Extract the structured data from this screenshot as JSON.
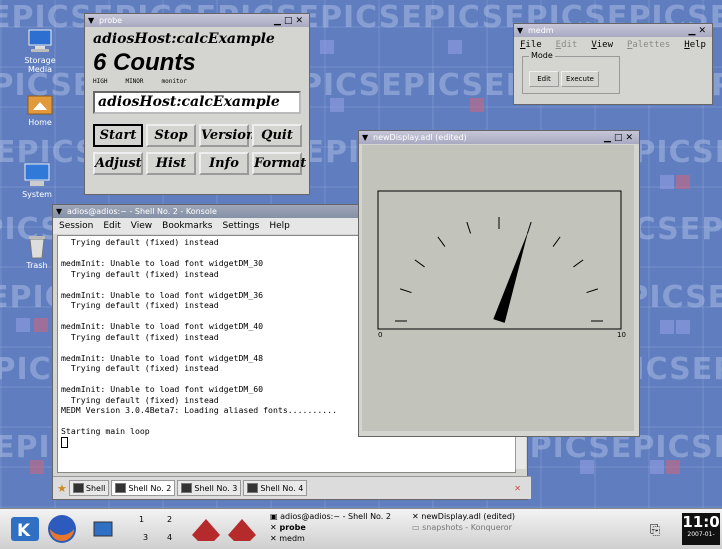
{
  "wallpaper": {
    "text": "EPICS"
  },
  "desktop_icons": [
    {
      "label": "Storage Media"
    },
    {
      "label": "Home"
    },
    {
      "label": "System"
    },
    {
      "label": "Trash"
    }
  ],
  "probe": {
    "title": "probe",
    "pv_name": "adiosHost:calcExample",
    "value": "6 Counts",
    "limit_labels": [
      "HIGH",
      "MINOR",
      "monitor"
    ],
    "entry_value": "adiosHost:calcExample",
    "buttons": [
      "Start",
      "Stop",
      "Version",
      "Quit",
      "Adjust",
      "Hist",
      "Info",
      "Format"
    ]
  },
  "medm": {
    "title": "medm",
    "menu": [
      "File",
      "Edit",
      "View",
      "Palettes",
      "Help"
    ],
    "mode_label": "Mode",
    "mode_buttons": [
      "Edit",
      "Execute"
    ]
  },
  "newdisplay": {
    "title": "newDisplay.adl (edited)",
    "meter": {
      "min_label": "0",
      "max_label": "10",
      "min": 0,
      "max": 10,
      "value": 6
    }
  },
  "konsole": {
    "title": "adios@adios:~ - Shell No. 2 - Konsole",
    "menu": [
      "Session",
      "Edit",
      "View",
      "Bookmarks",
      "Settings",
      "Help"
    ],
    "lines": [
      "  Trying default (fixed) instead",
      "",
      "medmInit: Unable to load font widgetDM_30",
      "  Trying default (fixed) instead",
      "",
      "medmInit: Unable to load font widgetDM_36",
      "  Trying default (fixed) instead",
      "",
      "medmInit: Unable to load font widgetDM_40",
      "  Trying default (fixed) instead",
      "",
      "medmInit: Unable to load font widgetDM_48",
      "  Trying default (fixed) instead",
      "",
      "medmInit: Unable to load font widgetDM_60",
      "  Trying default (fixed) instead",
      "MEDM Version 3.0.4Beta7: Loading aliased fonts..........",
      "",
      "Starting main loop",
      ""
    ],
    "tabs": [
      "Shell",
      "Shell No. 2",
      "Shell No. 3",
      "Shell No. 4"
    ]
  },
  "taskbar": {
    "desktops": [
      "1",
      "2",
      "3",
      "4"
    ],
    "tasks": [
      {
        "label": "adios@adios:~ - Shell No. 2"
      },
      {
        "label": "probe"
      },
      {
        "label": "medm"
      },
      {
        "label": "newDisplay.adl (edited)"
      },
      {
        "label": "snapshots - Konqueror"
      }
    ],
    "clock_time": "11:0",
    "clock_date": "2007-01-"
  }
}
